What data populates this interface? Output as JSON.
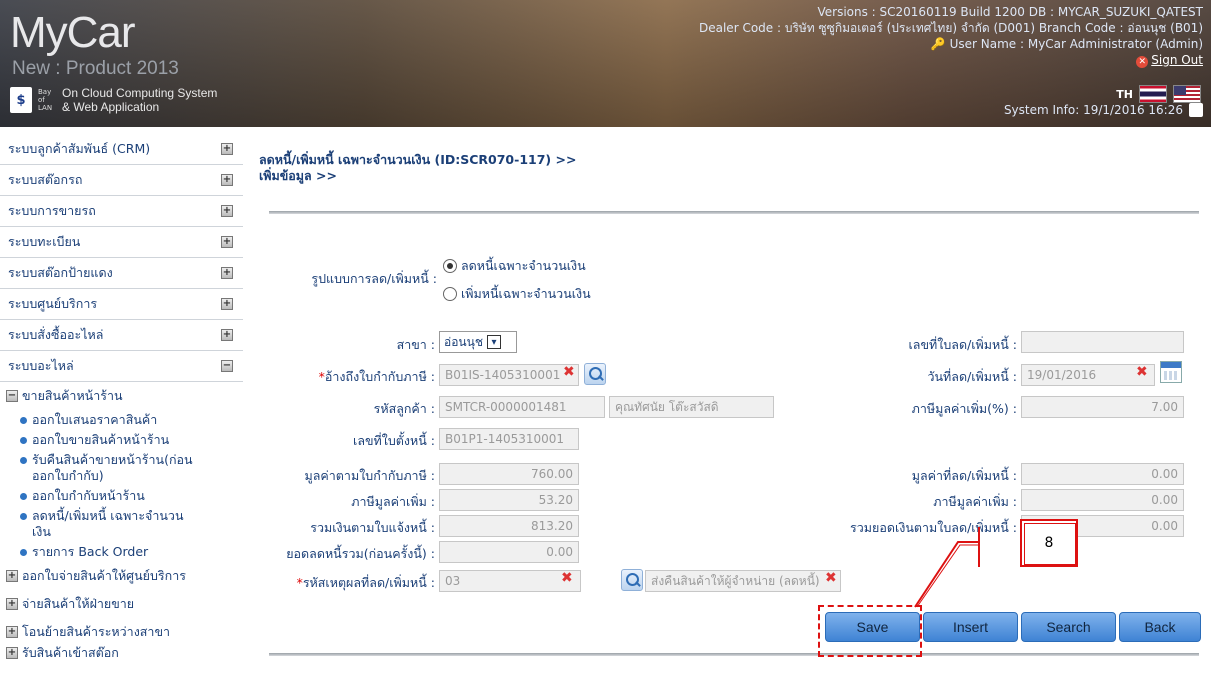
{
  "header": {
    "logo": "MyCar",
    "logo_sub": "New : Product 2013",
    "system_line1": "On Cloud Computing System",
    "system_line2": "& Web Application",
    "suzuki_label": "SUZUKI",
    "bay_label": "Bay of LAN",
    "versions": "Versions : SC20160119 Build 1200 DB : MYCAR_SUZUKI_QATEST",
    "dealer": "Dealer Code : บริษัท ซูซูกิมอเตอร์ (ประเทศไทย) จำกัด (D001)  Branch Code : อ่อนนุช (B01)",
    "user": "User Name : MyCar Administrator  (Admin)",
    "signout": "Sign Out",
    "lang": "TH",
    "sysinfo": "System Info: 19/1/2016 16:26"
  },
  "sidebar": {
    "items": [
      {
        "label": "ระบบลูกค้าสัมพันธ์ (CRM)",
        "toggle": "+"
      },
      {
        "label": "ระบบสต๊อกรถ",
        "toggle": "+"
      },
      {
        "label": "ระบบการขายรถ",
        "toggle": "+"
      },
      {
        "label": "ระบบทะเบียน",
        "toggle": "+"
      },
      {
        "label": "ระบบสต๊อกป้ายแดง",
        "toggle": "+"
      },
      {
        "label": "ระบบศูนย์บริการ",
        "toggle": "+"
      },
      {
        "label": "ระบบสั่งซื้ออะไหล่",
        "toggle": "+"
      },
      {
        "label": "ระบบอะไหล่",
        "toggle": "−"
      }
    ],
    "sub_group": "ขายสินค้าหน้าร้าน",
    "sub_items": [
      "ออกใบเสนอราคาสินค้า",
      "ออกใบขายสินค้าหน้าร้าน",
      "รับคืนสินค้าขายหน้าร้าน(ก่อน ออกใบกำกับ)",
      "ออกใบกำกับหน้าร้าน",
      "ลดหนี้/เพิ่มหนี้ เฉพาะจำนวน เงิน",
      "รายการ Back Order"
    ],
    "other_groups": [
      "ออกใบจ่ายสินค้าให้ศูนย์บริการ",
      "จ่ายสินค้าให้ฝ่ายขาย",
      "โอนย้ายสินค้าระหว่างสาขา",
      "รับสินค้าเข้าสต๊อก"
    ]
  },
  "page": {
    "title_line1": "ลดหนี้/เพิ่มหนี้ เฉพาะจำนวนเงิน (ID:SCR070-117) >>",
    "title_line2": "เพิ่มข้อมูล >>"
  },
  "form": {
    "type_label": "รูปแบบการลด/เพิ่มหนี้ :",
    "radio1": "ลดหนี้เฉพาะจำนวนเงิน",
    "radio2": "เพิ่มหนี้เฉพาะจำนวนเงิน",
    "branch_label": "สาขา :",
    "branch_value": "อ่อนนุช",
    "ref_invoice_label": "อ้างถึงใบกำกับภาษี :",
    "ref_invoice_value": "B01IS-1405310001",
    "customer_label": "รหัสลูกค้า :",
    "customer_code": "SMTCR-0000001481",
    "customer_name": "คุณทัศนัย โต๊ะสวัสดิ",
    "debt_no_label": "เลขที่ใบตั้งหนี้ :",
    "debt_no_value": "B01P1-1405310001",
    "invoice_value_label": "มูลค่าตามใบกำกับภาษี :",
    "invoice_value": "760.00",
    "vat_label": "ภาษีมูลค่าเพิ่ม :",
    "vat_value": "53.20",
    "total_label": "รวมเงินตามใบแจ้งหนี้ :",
    "total_value": "813.20",
    "prev_total_label": "ยอดลดหนี้รวม(ก่อนครั้งนี้) :",
    "prev_total_value": "0.00",
    "reason_label": "รหัสเหตุผลที่ลด/เพิ่มหนี้ :",
    "reason_code": "03",
    "reason_text": "ส่งคืนสินค้าให้ผู้จำหน่าย (ลดหนี้)",
    "doc_no_label": "เลขที่ใบลด/เพิ่มหนี้ :",
    "doc_no_value": "",
    "date_label": "วันที่ลด/เพิ่มหนี้ :",
    "date_value": "19/01/2016",
    "vat_rate_label": "ภาษีมูลค่าเพิ่ม(%) :",
    "vat_rate_value": "7.00",
    "adj_value_label": "มูลค่าที่ลด/เพิ่มหนี้ :",
    "adj_value": "0.00",
    "adj_vat_label": "ภาษีมูลค่าเพิ่ม :",
    "adj_vat": "0.00",
    "adj_total_label": "รวมยอดเงินตามใบลด/เพิ่มหนี้ :",
    "adj_total": "0.00"
  },
  "buttons": {
    "save": "Save",
    "insert": "Insert",
    "search": "Search",
    "back": "Back"
  },
  "annotation": {
    "number": "8"
  }
}
